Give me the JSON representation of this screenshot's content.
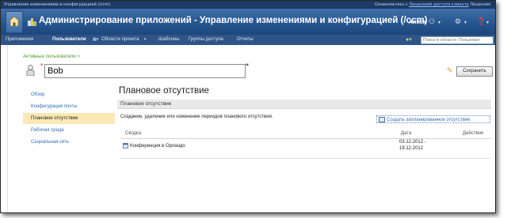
{
  "topbar": {
    "left_text": "Управление изменениями и конфигурацией (/ccm)",
    "right_prefix": "Ознакомьтесь с",
    "right_link": "Лицензией доступа клиента",
    "right_suffix": "Лицензия"
  },
  "header": {
    "title": "Администрирование приложений - Управление изменениями и конфигурацией (/ccm)",
    "user": "Алиса"
  },
  "nav": {
    "items": [
      "Приложения",
      "Пользователи",
      "Области проекта",
      "Шаблоны",
      "Группы доступа",
      "Отчеты"
    ],
    "active_index": 1,
    "search_placeholder": "Поиск в области: Пользоват"
  },
  "page": {
    "breadcrumb": "Активные пользователи >",
    "user_name": "Bob",
    "required_marker": "*",
    "save_label": "Сохранить"
  },
  "sidebar": {
    "items": [
      "Обзор",
      "Конфигурация почты",
      "Плановое отсутствие",
      "Рабочая среда",
      "Социальная сеть"
    ],
    "active_index": 2
  },
  "main": {
    "title": "Плановое отсутствие",
    "section_title": "Плановое отсутствие",
    "description": "Создание, удаление или изменение периодов планового отсутствия.",
    "create_label": "Создать запланированное отсутствие",
    "columns": [
      "Сводка",
      "Дата",
      "Действия"
    ],
    "rows": [
      {
        "summary": "Конференция в Орландо",
        "date_from": "03.12.2012 -",
        "date_to": "19.12.2012"
      }
    ]
  },
  "colors": {
    "header_blue": "#27568f",
    "nav_blue": "#2e5488",
    "link_blue": "#2e6fb7",
    "active_bg": "#fbe8b5",
    "breadcrumb_green": "#4f9a2b"
  }
}
